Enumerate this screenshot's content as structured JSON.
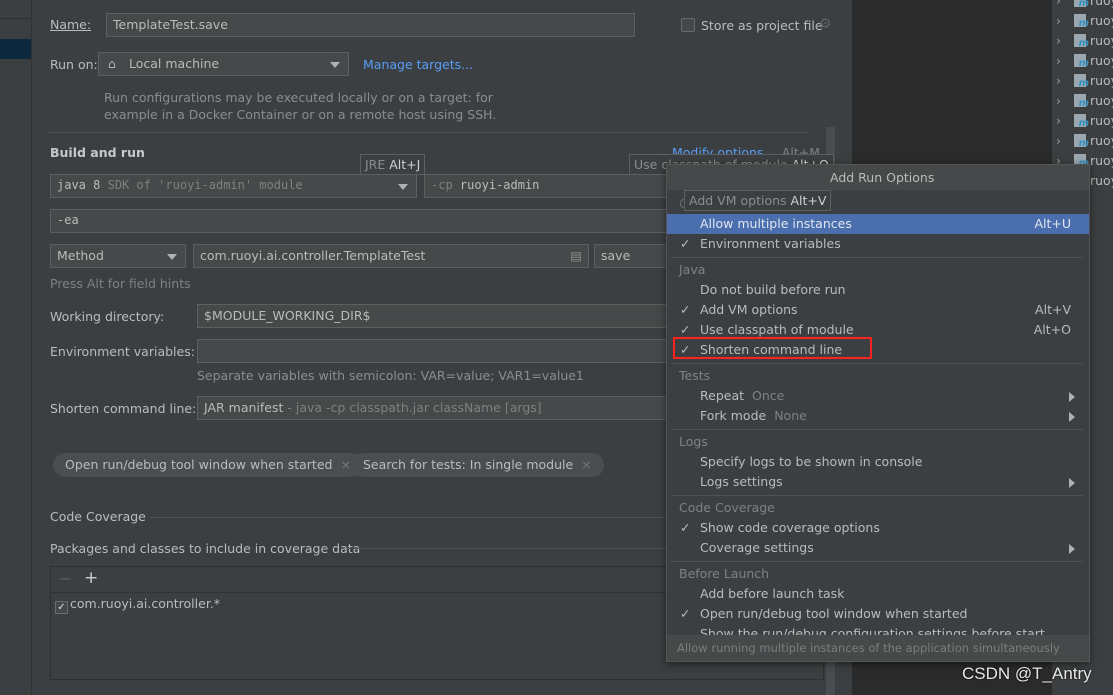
{
  "dialog": {
    "name_label": "Name:",
    "name_value": "TemplateTest.save",
    "store_label": "Store as project file",
    "run_on_label": "Run on:",
    "run_on_value": "Local machine",
    "manage_targets": "Manage targets...",
    "run_on_help_1": "Run configurations may be executed locally or on a target: for",
    "run_on_help_2": "example in a Docker Container or on a remote host using SSH.",
    "build_and_run": "Build and run",
    "modify_options": "Modify options",
    "modify_shortcut": "Alt+M",
    "jre_hint": {
      "text": "JRE ",
      "key": "Alt+J"
    },
    "cp_hint": {
      "text": "Use classpath of module ",
      "key": "Alt+O"
    },
    "vm_hint": {
      "text": "Add VM options ",
      "key": "Alt+V"
    },
    "jre_main": "java 8",
    "jre_dim": "SDK of 'ruoyi-admin' module",
    "cp_prefix": "-cp",
    "cp_value": "ruoyi-admin",
    "vm_options": "-ea",
    "test_kind": "Method",
    "test_class": "com.ruoyi.ai.controller.TemplateTest",
    "test_method": "save",
    "field_hints": "Press Alt for field hints",
    "working_dir_label": "Working directory:",
    "working_dir_value": "$MODULE_WORKING_DIR$",
    "env_label": "Environment variables:",
    "env_value": "",
    "env_help": "Separate variables with semicolon: VAR=value; VAR1=value1",
    "shorten_label": "Shorten command line:",
    "shorten_value": "JAR manifest",
    "shorten_dim": " - java -cp classpath.jar className [args]",
    "chips": [
      "Open run/debug tool window when started",
      "Search for tests: In single module"
    ],
    "code_coverage": "Code Coverage",
    "packages_label": "Packages and classes to include in coverage data",
    "coverage_items": [
      {
        "label": "com.ruoyi.ai.controller.*",
        "checked": true
      }
    ]
  },
  "popup": {
    "title": "Add Run Options",
    "items": [
      {
        "label": "Allow multiple instances",
        "shortcut": "Alt+U",
        "selected": true
      },
      {
        "label": "Environment variables",
        "checked": true
      }
    ],
    "groups": [
      {
        "name": "Java",
        "items": [
          {
            "label": "Do not build before run"
          },
          {
            "label": "Add VM options",
            "checked": true,
            "shortcut": "Alt+V"
          },
          {
            "label": "Use classpath of module",
            "checked": true,
            "shortcut": "Alt+O"
          },
          {
            "label": "Shorten command line",
            "checked": true,
            "highlighted": true
          }
        ]
      },
      {
        "name": "Tests",
        "items": [
          {
            "label": "Repeat",
            "value": "Once",
            "submenu": true
          },
          {
            "label": "Fork mode",
            "value": "None",
            "submenu": true
          }
        ]
      },
      {
        "name": "Logs",
        "items": [
          {
            "label": "Specify logs to be shown in console"
          },
          {
            "label": "Logs settings",
            "submenu": true
          }
        ]
      },
      {
        "name": "Code Coverage",
        "items": [
          {
            "label": "Show code coverage options",
            "checked": true
          },
          {
            "label": "Coverage settings",
            "submenu": true
          }
        ]
      },
      {
        "name": "Before Launch",
        "items": [
          {
            "label": "Add before launch task"
          },
          {
            "label": "Open run/debug tool window when started",
            "checked": true
          },
          {
            "label": "Show the run/debug configuration settings before start"
          }
        ]
      }
    ],
    "footer": "Allow running multiple instances of the application simultaneously"
  },
  "tree": {
    "items": [
      "ruoyi",
      "ruoyi",
      "ruoyi",
      "ruoyi",
      "ruoyi",
      "ruoyi",
      "ruoyi",
      "ruoyi",
      "ruoyi",
      "ruoyi"
    ]
  },
  "watermark": "CSDN @T_Antry",
  "colors": {
    "accent": "#4b6eaf",
    "link": "#589df6",
    "highlight_box": "#ff2020"
  }
}
